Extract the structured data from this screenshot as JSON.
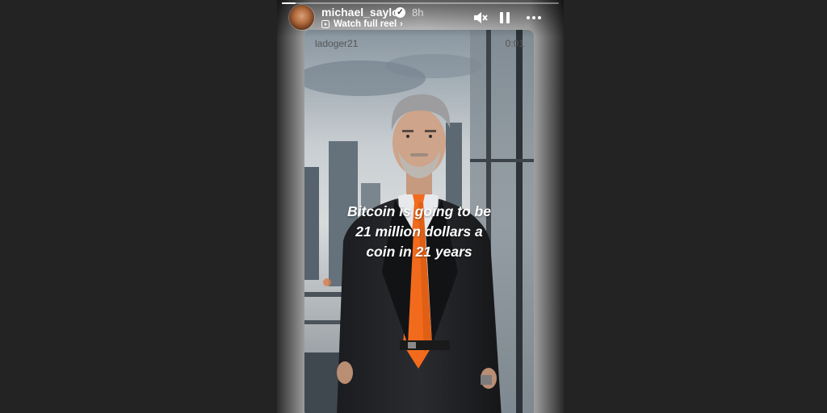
{
  "story": {
    "username": "michael_saylor",
    "time_ago": "8h",
    "watch_full_reel": "Watch full reel",
    "progress": 0.05
  },
  "reel": {
    "username": "ladoger21",
    "timestamp": "0:01",
    "caption_lines": [
      "Bitcoin is going to be",
      "21 million dollars a",
      "coin in 21 years"
    ]
  },
  "icons": {
    "verified": "verified-badge-icon",
    "reel": "reel-icon",
    "chevron": "chevron-right-icon",
    "mute": "speaker-muted-icon",
    "pause": "pause-icon",
    "more": "more-horizontal-icon"
  },
  "colors": {
    "page_bg": "#232323",
    "tie": "#f26b1d",
    "text": "#ffffff"
  }
}
